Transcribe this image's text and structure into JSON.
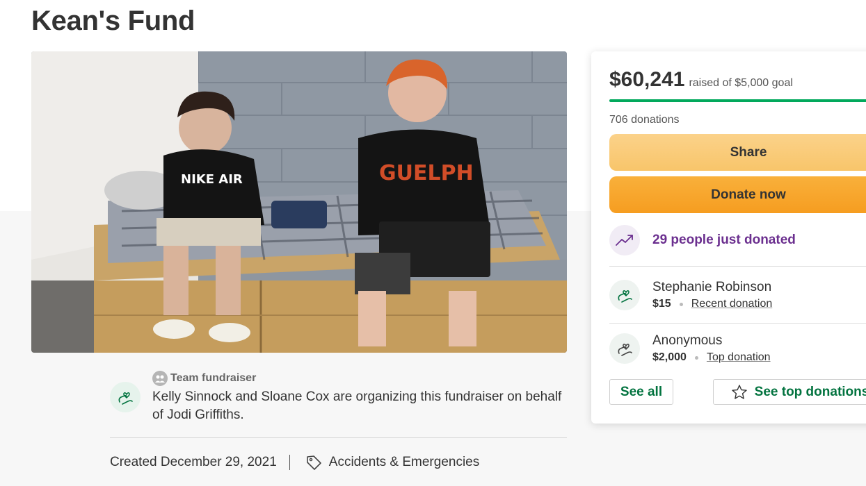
{
  "page": {
    "title": "Kean's Fund"
  },
  "hero": {
    "image_description": "hero-photo"
  },
  "organizer": {
    "team_label": "Team fundraiser",
    "text": "Kelly Sinnock and Sloane Cox are organizing this fundraiser on behalf of Jodi Griffiths."
  },
  "meta": {
    "created": "Created December 29, 2021",
    "category": "Accidents & Emergencies"
  },
  "donation_panel": {
    "raised_amount": "$60,241",
    "raised_goal_text": "raised of $5,000 goal",
    "progress_percent": 100,
    "donation_count": "706 donations",
    "share_label": "Share",
    "donate_label": "Donate now",
    "trend_text": "29 people just donated",
    "donations": [
      {
        "name": "Stephanie Robinson",
        "amount": "$15",
        "badge": "Recent donation"
      },
      {
        "name": "Anonymous",
        "amount": "$2,000",
        "badge": "Top donation"
      }
    ],
    "see_all_label": "See all",
    "see_top_label": "See top donations"
  },
  "colors": {
    "brand_green": "#02a95c",
    "share_yellow": "#f8c56a",
    "donate_orange": "#f69d20",
    "trend_purple": "#6b2f8f"
  },
  "icons": [
    "heart-hands-icon",
    "team-icon",
    "tag-icon",
    "trending-up-icon",
    "star-icon"
  ]
}
